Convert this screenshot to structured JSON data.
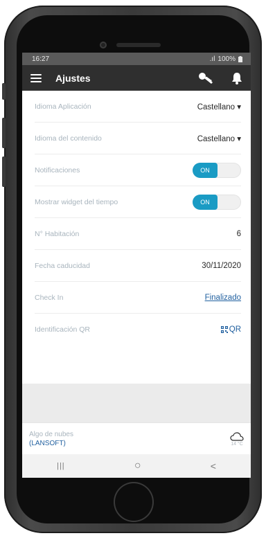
{
  "status_bar": {
    "time": "16:27",
    "signal": "  .ıl",
    "battery": "100%"
  },
  "app_bar": {
    "title": "Ajustes"
  },
  "settings": [
    {
      "label": "Idioma Aplicación",
      "value": "Castellano ▾"
    },
    {
      "label": "Idioma del contenido",
      "value": "Castellano ▾"
    },
    {
      "label": "Notificaciones",
      "toggle": "ON"
    },
    {
      "label": "Mostrar widget del tiempo",
      "toggle": "ON"
    },
    {
      "label": "N° Habitación",
      "value": "6"
    },
    {
      "label": "Fecha caducidad",
      "value": "30/11/2020"
    },
    {
      "label": "Check In",
      "link": "Finalizado"
    },
    {
      "label": "Identificación QR",
      "qr_label": "QR"
    }
  ],
  "weather": {
    "description": "Algo de nubes",
    "source": "(LANSOFT)",
    "temperature": "14 °C"
  },
  "nav": {
    "recent": "|||",
    "home": "○",
    "back": "<"
  },
  "colors": {
    "appbar": "#2f2f2f",
    "accent": "#1a9bc4",
    "link": "#1f5f9f",
    "label": "#a8b4bd"
  },
  "icons": [
    "menu-icon",
    "key-icon",
    "bell-icon",
    "qr-icon",
    "cloud-icon",
    "battery-icon"
  ]
}
